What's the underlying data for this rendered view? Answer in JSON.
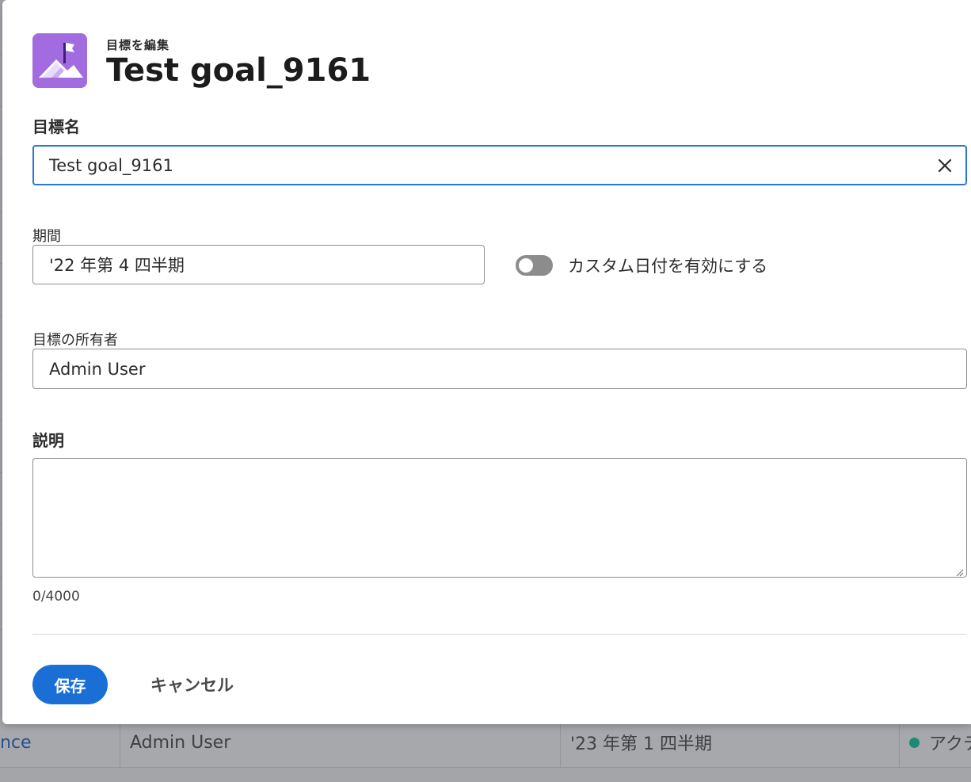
{
  "modal": {
    "eyebrow": "目標を編集",
    "title": "Test goal_9161",
    "icon": "goal-flag-mountain-icon",
    "accent_color": "#a36be0"
  },
  "fields": {
    "goal_name": {
      "label": "目標名",
      "value": "Test goal_9161"
    },
    "period": {
      "label": "期間",
      "value": "'22 年第 4 四半期"
    },
    "custom_dates": {
      "label": "カスタム日付を有効にする",
      "enabled": false
    },
    "owner": {
      "label": "目標の所有者",
      "value": "Admin User"
    },
    "description": {
      "label": "説明",
      "value": "",
      "counter": "0/4000"
    }
  },
  "actions": {
    "save_label": "保存",
    "cancel_label": "キャンセル"
  },
  "background_row": {
    "name_fragment": "nce",
    "owner": "Admin User",
    "period": "'23 年第 1 四半期",
    "status": "アクテ",
    "status_color": "#1f8a73"
  }
}
